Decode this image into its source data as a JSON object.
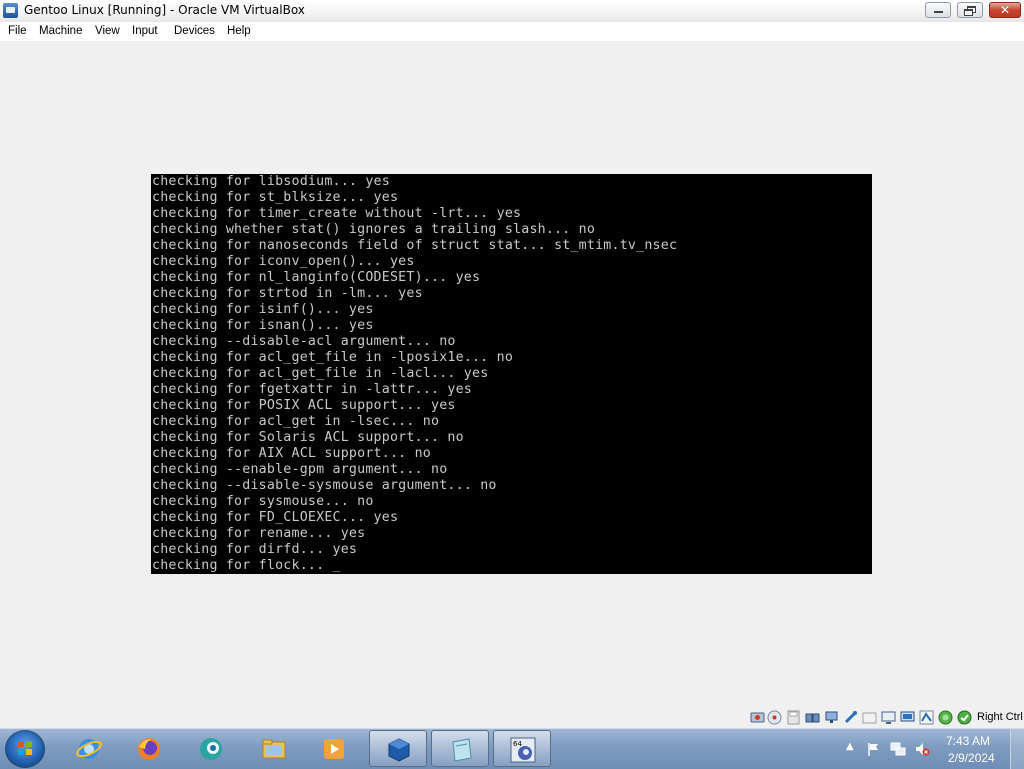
{
  "window": {
    "title": "Gentoo Linux [Running] - Oracle VM VirtualBox"
  },
  "menu": {
    "items": [
      "File",
      "Machine",
      "View",
      "Input",
      "Devices",
      "Help"
    ]
  },
  "console": {
    "lines": [
      "checking for libsodium... yes",
      "checking for st_blksize... yes",
      "checking for timer_create without -lrt... yes",
      "checking whether stat() ignores a trailing slash... no",
      "checking for nanoseconds field of struct stat... st_mtim.tv_nsec",
      "checking for iconv_open()... yes",
      "checking for nl_langinfo(CODESET)... yes",
      "checking for strtod in -lm... yes",
      "checking for isinf()... yes",
      "checking for isnan()... yes",
      "checking --disable-acl argument... no",
      "checking for acl_get_file in -lposix1e... no",
      "checking for acl_get_file in -lacl... yes",
      "checking for fgetxattr in -lattr... yes",
      "checking for POSIX ACL support... yes",
      "checking for acl_get in -lsec... no",
      "checking for Solaris ACL support... no",
      "checking for AIX ACL support... no",
      "checking --enable-gpm argument... no",
      "checking --disable-sysmouse argument... no",
      "checking for sysmouse... no",
      "checking for FD_CLOEXEC... yes",
      "checking for rename... yes",
      "checking for dirfd... yes",
      "checking for flock... _"
    ]
  },
  "statusbar": {
    "host_key": "Right Ctrl",
    "icons": [
      "hard-disk-icon",
      "optical-drive-icon",
      "floppy-icon",
      "audio-icon",
      "network-icon",
      "usb-icon",
      "shared-folders-icon",
      "display-icon",
      "video-capture-icon",
      "recording-icon",
      "virtualization-icon",
      "mouse-integration-icon",
      "keyboard-icon"
    ]
  },
  "taskbar": {
    "pinned": [
      "internet-explorer-icon",
      "firefox-icon",
      "browser-icon",
      "file-explorer-icon",
      "media-player-icon",
      "virtualbox-icon",
      "notepad-icon",
      "gentoo-vm-icon"
    ],
    "clock_time": "7:43 AM",
    "clock_date": "2/9/2024",
    "colors": {
      "taskbar": "#7e9bc0",
      "console_bg": "#000000",
      "console_fg": "#c8c8c8"
    }
  }
}
